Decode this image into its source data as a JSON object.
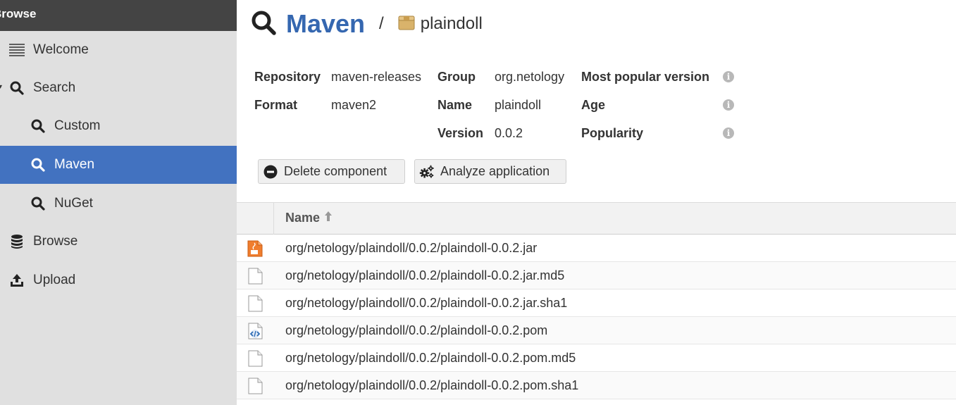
{
  "sidebar": {
    "header": "Browse",
    "items": [
      {
        "label": "Welcome",
        "icon": "list-icon"
      },
      {
        "label": "Search",
        "icon": "search-icon"
      },
      {
        "label": "Custom",
        "icon": "search-icon"
      },
      {
        "label": "Maven",
        "icon": "search-icon",
        "active": true
      },
      {
        "label": "NuGet",
        "icon": "search-icon"
      },
      {
        "label": "Browse",
        "icon": "database-icon"
      },
      {
        "label": "Upload",
        "icon": "upload-icon"
      }
    ]
  },
  "header": {
    "title": "Maven",
    "separator": "/",
    "component": "plaindoll"
  },
  "details": {
    "repository_label": "Repository",
    "repository_value": "maven-releases",
    "format_label": "Format",
    "format_value": "maven2",
    "group_label": "Group",
    "group_value": "org.netology",
    "name_label": "Name",
    "name_value": "plaindoll",
    "version_label": "Version",
    "version_value": "0.0.2",
    "most_popular_label": "Most popular version",
    "age_label": "Age",
    "popularity_label": "Popularity"
  },
  "actions": {
    "delete_label": "Delete component",
    "analyze_label": "Analyze application"
  },
  "grid": {
    "name_header": "Name",
    "rows": [
      {
        "name": "org/netology/plaindoll/0.0.2/plaindoll-0.0.2.jar",
        "icon": "jar-file-icon"
      },
      {
        "name": "org/netology/plaindoll/0.0.2/plaindoll-0.0.2.jar.md5",
        "icon": "file-icon"
      },
      {
        "name": "org/netology/plaindoll/0.0.2/plaindoll-0.0.2.jar.sha1",
        "icon": "file-icon"
      },
      {
        "name": "org/netology/plaindoll/0.0.2/plaindoll-0.0.2.pom",
        "icon": "xml-file-icon"
      },
      {
        "name": "org/netology/plaindoll/0.0.2/plaindoll-0.0.2.pom.md5",
        "icon": "file-icon"
      },
      {
        "name": "org/netology/plaindoll/0.0.2/plaindoll-0.0.2.pom.sha1",
        "icon": "file-icon"
      }
    ]
  },
  "colors": {
    "accent": "#4272c0",
    "title": "#3567b0",
    "sidebar_bg": "#e0e0e0",
    "sidebar_header_bg": "#444444"
  }
}
